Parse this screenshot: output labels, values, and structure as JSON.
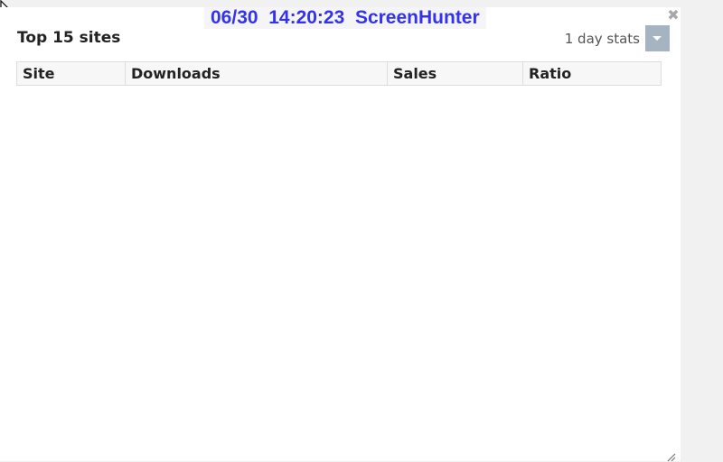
{
  "watermark": "06/30  14:20:23  ScreenHunter",
  "widget": {
    "title": "Top 15 sites",
    "stats_selected": "1 day stats"
  },
  "table": {
    "columns": [
      "Site",
      "Downloads",
      "Sales",
      "Ratio"
    ],
    "rows": []
  },
  "icons": {
    "close": "close-icon",
    "dropdown": "chevron-down-icon",
    "resize": "resize-grip-icon",
    "cursor": "mouse-cursor-icon"
  },
  "colors": {
    "watermark": "#3333ee",
    "dropdown_button": "#a6b3c1"
  }
}
